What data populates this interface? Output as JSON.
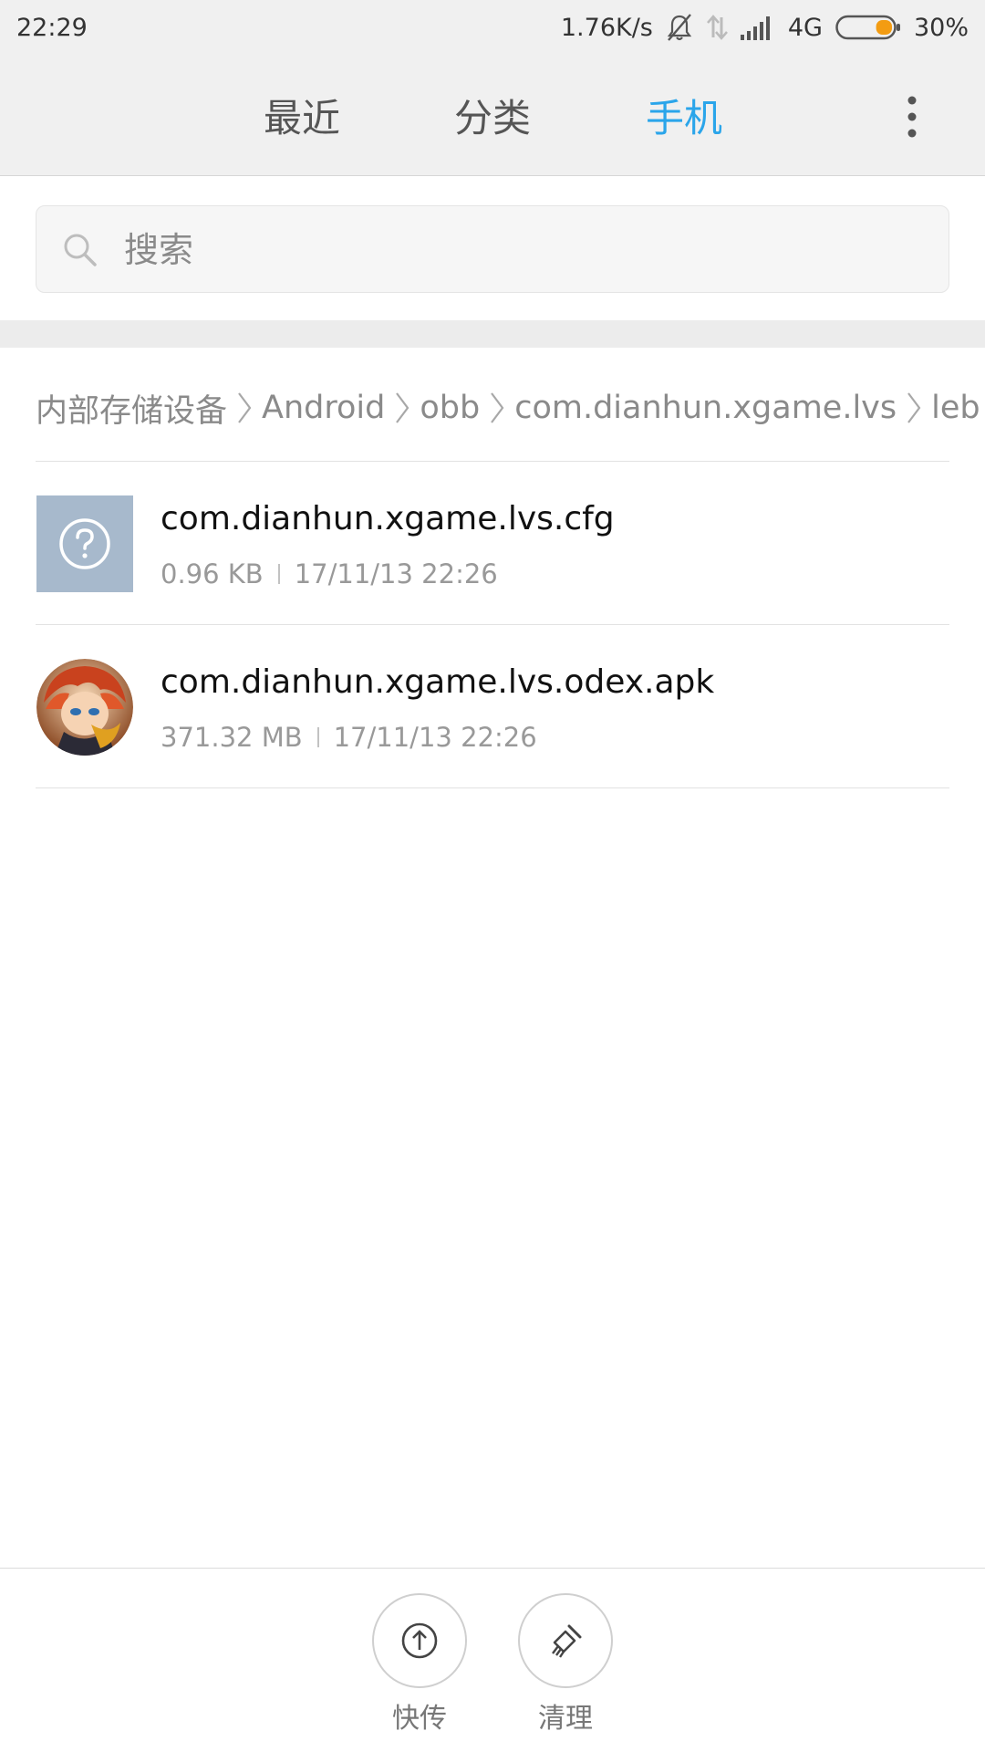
{
  "status_bar": {
    "time": "22:29",
    "net_speed": "1.76K/s",
    "network_type": "4G",
    "battery_percent": "30%",
    "battery_level": 0.3,
    "battery_color": "#f39c12"
  },
  "tabs": [
    {
      "label": "最近",
      "active": false
    },
    {
      "label": "分类",
      "active": false
    },
    {
      "label": "手机",
      "active": true
    }
  ],
  "accent_color": "#2aa5ea",
  "search": {
    "placeholder": "搜索",
    "value": ""
  },
  "breadcrumb": [
    "内部存储设备",
    "Android",
    "obb",
    "com.dianhun.xgame.lvs",
    "leb"
  ],
  "files": [
    {
      "name": "com.dianhun.xgame.lvs.cfg",
      "size": "0.96 KB",
      "date": "17/11/13 22:26",
      "icon": "unknown-file-icon"
    },
    {
      "name": "com.dianhun.xgame.lvs.odex.apk",
      "size": "371.32 MB",
      "date": "17/11/13 22:26",
      "icon": "app-avatar-icon"
    }
  ],
  "actions": {
    "share_label": "快传",
    "clean_label": "清理"
  }
}
